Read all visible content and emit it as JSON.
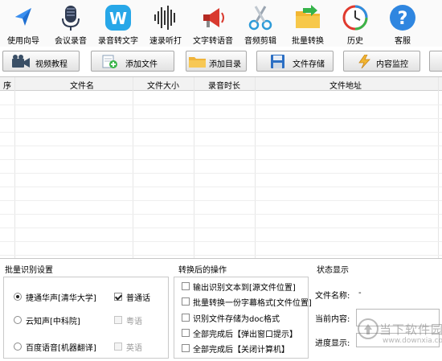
{
  "toolbar": {
    "items": [
      {
        "label": "使用向导",
        "icon": "navigation-arrow-icon"
      },
      {
        "label": "会议录音",
        "icon": "microphone-icon"
      },
      {
        "label": "录音转文字",
        "icon": "w-badge-icon"
      },
      {
        "label": "速录听打",
        "icon": "sound-wave-icon"
      },
      {
        "label": "文字转语音",
        "icon": "megaphone-icon"
      },
      {
        "label": "音频剪辑",
        "icon": "scissors-icon"
      },
      {
        "label": "批量转换",
        "icon": "folder-arrow-icon"
      },
      {
        "label": "历史",
        "icon": "history-clock-icon"
      },
      {
        "label": "客服",
        "icon": "help-question-icon"
      }
    ]
  },
  "buttons": {
    "video_tutorial": "视频教程",
    "add_file": "添加文件",
    "add_dir": "添加目录",
    "save_files": "文件存储",
    "monitor": "内容监控"
  },
  "table": {
    "headers": [
      "序",
      "文件名",
      "文件大小",
      "录音时长",
      "文件地址"
    ]
  },
  "batch": {
    "title": "批量识别设置",
    "engines": [
      {
        "label": "捷通华声[清华大学]",
        "selected": true
      },
      {
        "label": "云知声[中科院]",
        "selected": false
      },
      {
        "label": "百度语音[机器翻译]",
        "selected": false
      }
    ],
    "languages": [
      {
        "label": "普通话",
        "checked": true,
        "enabled": true
      },
      {
        "label": "粤语",
        "checked": false,
        "enabled": false
      },
      {
        "label": "英语",
        "checked": false,
        "enabled": false
      }
    ]
  },
  "after": {
    "title": "转换后的操作",
    "options": [
      "输出识别文本到[源文件位置]",
      "批量转换一份字幕格式[文件位置]",
      "识别文件存储为doc格式",
      "全部完成后【弹出窗口提示】",
      "全部完成后【关闭计算机】"
    ]
  },
  "status": {
    "title": "状态显示",
    "filename_label": "文件名称:",
    "filename_value": "-",
    "current_label": "当前内容:",
    "progress_label": "进度显示:"
  },
  "watermark": {
    "text": "当下软件园",
    "url": "www.downxia.com"
  },
  "colors": {
    "accent_blue": "#2d8ce6",
    "toolbar_bg": "#fafafa"
  }
}
